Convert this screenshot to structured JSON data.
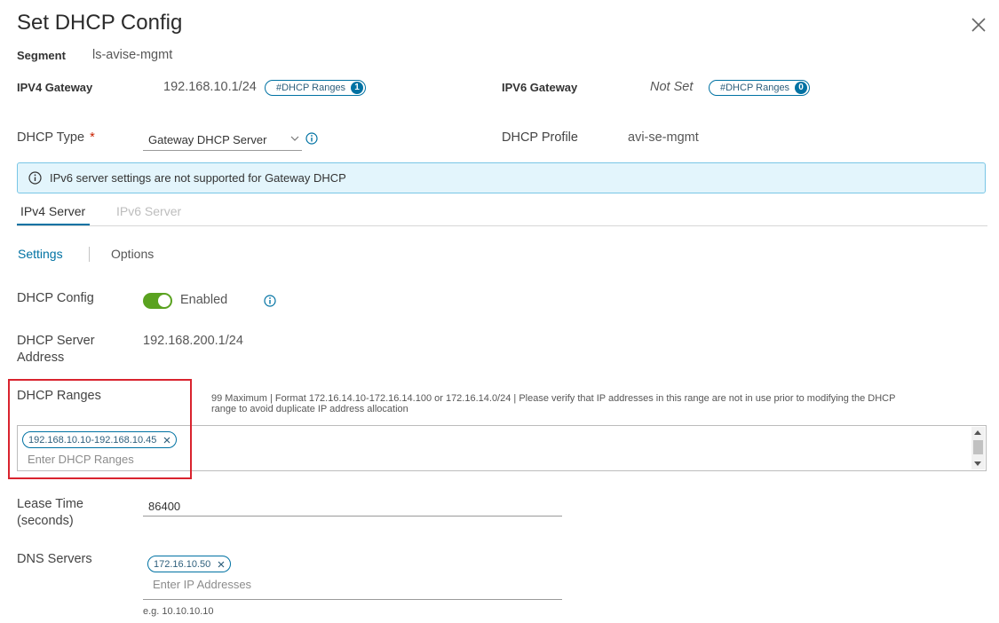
{
  "dialog": {
    "title": "Set DHCP Config"
  },
  "segment": {
    "label": "Segment",
    "value": "ls-avise-mgmt"
  },
  "ipv4_gateway": {
    "label": "IPV4 Gateway",
    "value": "192.168.10.1/24",
    "ranges_label": "#DHCP Ranges",
    "ranges_count": "1"
  },
  "ipv6_gateway": {
    "label": "IPV6 Gateway",
    "value": "Not Set",
    "ranges_label": "#DHCP Ranges",
    "ranges_count": "0"
  },
  "dhcp_type": {
    "label": "DHCP Type",
    "required_mark": "*",
    "selected": "Gateway DHCP Server"
  },
  "dhcp_profile": {
    "label": "DHCP Profile",
    "value": "avi-se-mgmt"
  },
  "alert": {
    "text": "IPv6 server settings are not supported for Gateway DHCP"
  },
  "tabs": [
    {
      "label": "IPv4 Server"
    },
    {
      "label": "IPv6 Server"
    }
  ],
  "subnav": [
    {
      "label": "Settings"
    },
    {
      "label": "Options"
    }
  ],
  "dhcp_config": {
    "label": "DHCP Config",
    "toggle_text": "Enabled",
    "enabled": true
  },
  "dhcp_server_address": {
    "label_line1": "DHCP Server",
    "label_line2": "Address",
    "value": "192.168.200.1/24"
  },
  "dhcp_ranges": {
    "label": "DHCP Ranges",
    "hint_line1": "99 Maximum | Format 172.16.14.10-172.16.14.100 or 172.16.14.0/24 | Please verify that IP addresses in this range are not in use prior to modifying the DHCP",
    "hint_line2": "range to avoid duplicate IP address allocation",
    "chips": [
      "192.168.10.10-192.168.10.45"
    ],
    "placeholder": "Enter DHCP Ranges"
  },
  "lease_time": {
    "label_line1": "Lease Time",
    "label_line2": "(seconds)",
    "value": "86400"
  },
  "dns_servers": {
    "label": "DNS Servers",
    "chips": [
      "172.16.10.50"
    ],
    "placeholder": "Enter IP Addresses",
    "example": "e.g. 10.10.10.10"
  },
  "colors": {
    "accent": "#0072a3",
    "toggle_on": "#5aa220",
    "required": "#c92100",
    "alert_bg": "#e3f5fc",
    "highlight": "#d9232e"
  }
}
